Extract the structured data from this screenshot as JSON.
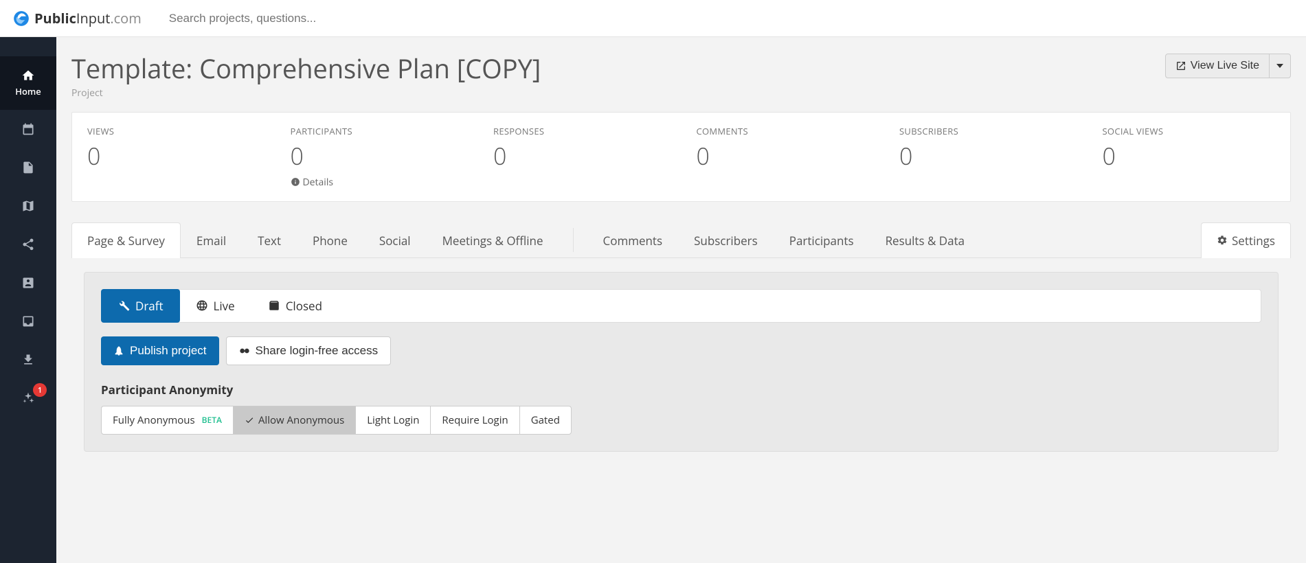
{
  "brand": {
    "main": "Public",
    "accent": "Input",
    "suffix": ".com"
  },
  "search": {
    "placeholder": "Search projects, questions..."
  },
  "sidebar": {
    "items": [
      {
        "name": "home",
        "label": "Home"
      },
      {
        "name": "calendar",
        "label": ""
      },
      {
        "name": "document",
        "label": ""
      },
      {
        "name": "map",
        "label": ""
      },
      {
        "name": "share",
        "label": ""
      },
      {
        "name": "contacts",
        "label": ""
      },
      {
        "name": "inbox",
        "label": ""
      },
      {
        "name": "download",
        "label": ""
      },
      {
        "name": "sparkle",
        "label": "",
        "badge": "1"
      }
    ]
  },
  "header": {
    "title": "Template: Comprehensive Plan [COPY]",
    "subtitle": "Project",
    "live_site_btn": "View Live Site"
  },
  "stats": [
    {
      "label": "VIEWS",
      "value": "0"
    },
    {
      "label": "PARTICIPANTS",
      "value": "0",
      "details": "Details"
    },
    {
      "label": "RESPONSES",
      "value": "0"
    },
    {
      "label": "COMMENTS",
      "value": "0"
    },
    {
      "label": "SUBSCRIBERS",
      "value": "0"
    },
    {
      "label": "SOCIAL VIEWS",
      "value": "0"
    }
  ],
  "tabs": {
    "page_survey": "Page & Survey",
    "email": "Email",
    "text": "Text",
    "phone": "Phone",
    "social": "Social",
    "meetings": "Meetings & Offline",
    "comments": "Comments",
    "subscribers": "Subscribers",
    "participants": "Participants",
    "results": "Results & Data",
    "settings": "Settings"
  },
  "status": {
    "draft": "Draft",
    "live": "Live",
    "closed": "Closed"
  },
  "actions": {
    "publish": "Publish project",
    "share": "Share login-free access"
  },
  "anonymity": {
    "heading": "Participant Anonymity",
    "fully": "Fully Anonymous",
    "beta": "BETA",
    "allow": "Allow Anonymous",
    "light": "Light Login",
    "require": "Require Login",
    "gated": "Gated"
  }
}
